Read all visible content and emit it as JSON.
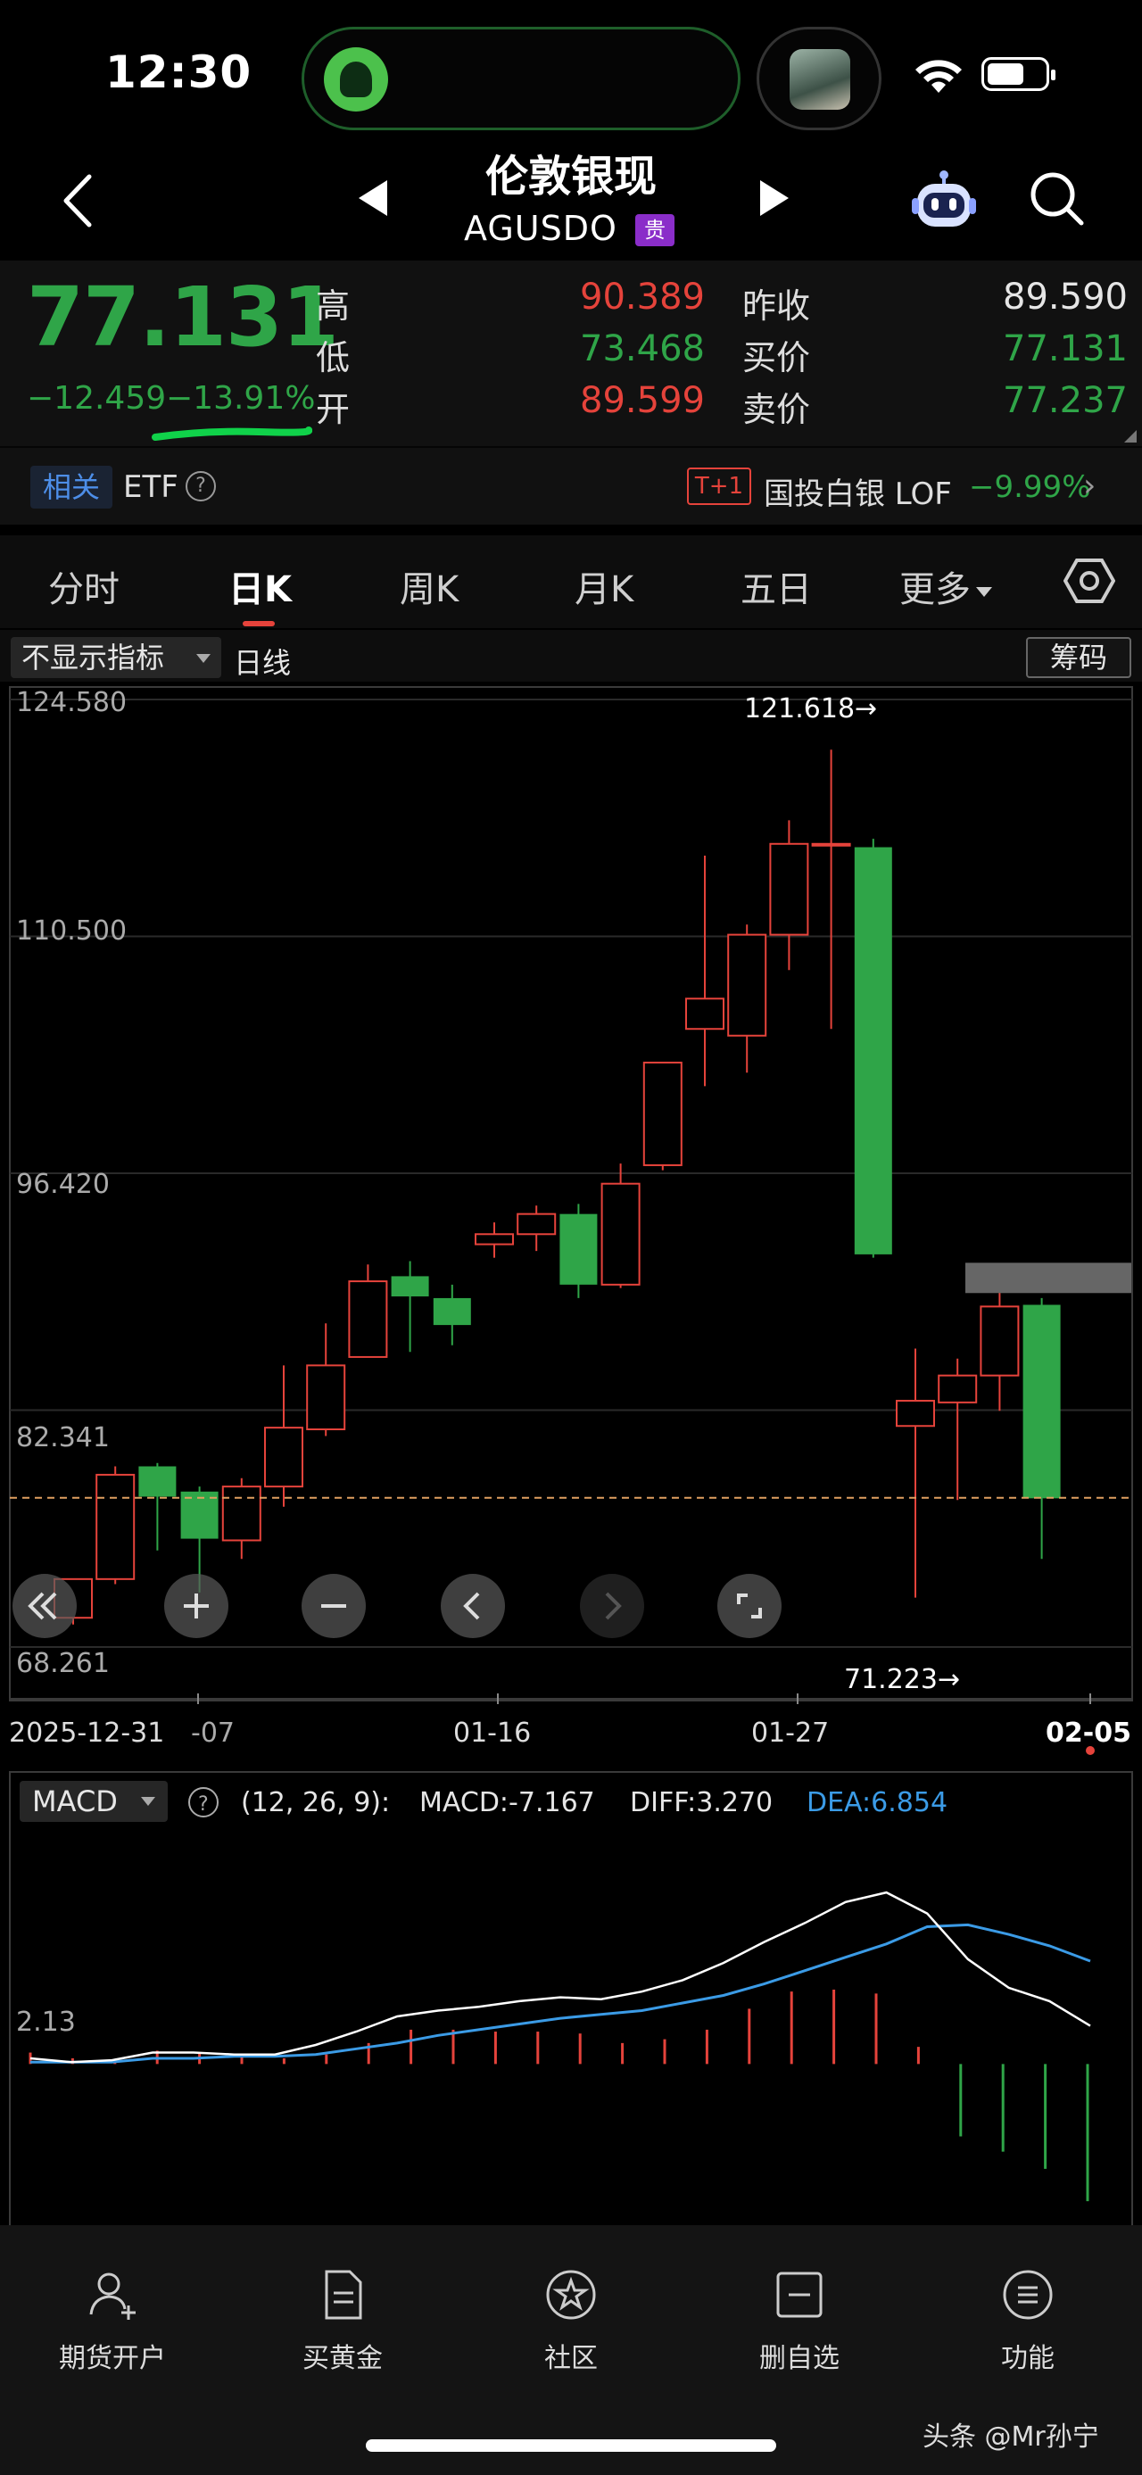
{
  "status": {
    "time": "12:30"
  },
  "header": {
    "title": "伦敦银现",
    "symbol": "AGUSDO",
    "badge": "贵"
  },
  "quote": {
    "price": "77.131",
    "change": "−12.459",
    "change_pct": "−13.91%",
    "rows": [
      {
        "label": "高",
        "value": "90.389",
        "label2": "昨收",
        "value2": "89.590"
      },
      {
        "label": "低",
        "value": "73.468",
        "label2": "买价",
        "value2": "77.131"
      },
      {
        "label": "开",
        "value": "89.599",
        "label2": "卖价",
        "value2": "77.237"
      }
    ]
  },
  "etf_bar": {
    "related": "相关",
    "etf": "ETF",
    "help": "?",
    "t1": "T+1",
    "lof_name": "国投白银 LOF",
    "lof_change": "−9.99%",
    "arrow": "›"
  },
  "tabs": [
    {
      "label": "分时"
    },
    {
      "label": "日K"
    },
    {
      "label": "周K"
    },
    {
      "label": "月K"
    },
    {
      "label": "五日"
    },
    {
      "label": "更多"
    }
  ],
  "indicator_bar": {
    "select": "不显示指标",
    "line": "日线",
    "chip_button": "筹码"
  },
  "colors": {
    "up": "#e5433b",
    "down": "#2fa548",
    "dif": "#ffffff",
    "dea": "#3b9be6"
  },
  "chart_data": {
    "type": "candlestick",
    "y_ticks": [
      "124.580",
      "110.500",
      "96.420",
      "82.341",
      "68.261"
    ],
    "ylim": [
      68.261,
      124.58
    ],
    "x_labels": [
      "2025-12-31",
      "-07",
      "01-16",
      "01-27",
      "02-05"
    ],
    "max_label": "121.618→",
    "min_label": "71.223→",
    "last_close": 77.131,
    "candles": [
      {
        "o": 70.0,
        "h": 72.0,
        "l": 69.6,
        "c": 72.3
      },
      {
        "o": 72.3,
        "h": 79.0,
        "l": 72.0,
        "c": 78.5
      },
      {
        "o": 79.0,
        "h": 79.2,
        "l": 74.0,
        "c": 77.2
      },
      {
        "o": 77.5,
        "h": 77.8,
        "l": 71.5,
        "c": 74.7
      },
      {
        "o": 74.6,
        "h": 78.3,
        "l": 73.5,
        "c": 77.8
      },
      {
        "o": 77.8,
        "h": 85.0,
        "l": 76.6,
        "c": 81.3
      },
      {
        "o": 81.2,
        "h": 87.5,
        "l": 80.8,
        "c": 85.0
      },
      {
        "o": 85.5,
        "h": 91.0,
        "l": 85.5,
        "c": 90.0
      },
      {
        "o": 90.3,
        "h": 91.2,
        "l": 85.8,
        "c": 89.1
      },
      {
        "o": 89.0,
        "h": 89.8,
        "l": 86.2,
        "c": 87.4
      },
      {
        "o": 92.2,
        "h": 93.5,
        "l": 91.4,
        "c": 92.8
      },
      {
        "o": 92.8,
        "h": 94.5,
        "l": 91.8,
        "c": 94.0
      },
      {
        "o": 94.0,
        "h": 94.6,
        "l": 89.0,
        "c": 89.8
      },
      {
        "o": 89.8,
        "h": 97.0,
        "l": 89.6,
        "c": 95.8
      },
      {
        "o": 96.9,
        "h": 103.0,
        "l": 96.6,
        "c": 103.0
      },
      {
        "o": 105.0,
        "h": 115.3,
        "l": 101.6,
        "c": 106.8
      },
      {
        "o": 104.6,
        "h": 111.2,
        "l": 102.4,
        "c": 110.6
      },
      {
        "o": 110.6,
        "h": 117.4,
        "l": 108.5,
        "c": 116.0
      },
      {
        "o": 116.0,
        "h": 121.6,
        "l": 105.0,
        "c": 116.0
      },
      {
        "o": 115.8,
        "h": 116.3,
        "l": 91.4,
        "c": 91.6
      },
      {
        "o": 81.4,
        "h": 86.0,
        "l": 71.2,
        "c": 82.9
      },
      {
        "o": 82.8,
        "h": 85.4,
        "l": 77.0,
        "c": 84.4
      },
      {
        "o": 84.4,
        "h": 89.6,
        "l": 82.3,
        "c": 88.5
      },
      {
        "o": 88.6,
        "h": 89.0,
        "l": 73.5,
        "c": 77.1
      }
    ],
    "ghost_bar": {
      "low": 89.3,
      "high": 91.1
    }
  },
  "macd": {
    "name": "MACD",
    "params": "(12, 26, 9):",
    "macd_text": "MACD:-7.167",
    "diff_text": "DIFF:3.270",
    "dea_text": "DEA:6.854",
    "axis_label": "2.13",
    "dif": [
      0.3,
      0.1,
      0.2,
      0.6,
      0.6,
      0.5,
      0.5,
      1.0,
      1.7,
      2.5,
      2.8,
      3.0,
      3.3,
      3.5,
      3.4,
      3.8,
      4.4,
      5.3,
      6.4,
      7.4,
      8.5,
      9.0,
      7.9,
      5.5,
      4.0,
      3.3,
      2.0
    ],
    "dea": [
      0.1,
      0.1,
      0.1,
      0.3,
      0.3,
      0.4,
      0.4,
      0.5,
      0.8,
      1.1,
      1.5,
      1.8,
      2.1,
      2.4,
      2.6,
      2.8,
      3.2,
      3.6,
      4.2,
      4.9,
      5.6,
      6.3,
      7.2,
      7.3,
      6.8,
      6.2,
      5.4
    ],
    "hist": [
      0.6,
      0.3,
      0.2,
      0.7,
      0.6,
      0.4,
      0.3,
      0.5,
      1.1,
      1.8,
      1.8,
      1.7,
      1.7,
      1.6,
      1.1,
      1.3,
      1.8,
      2.9,
      3.8,
      3.9,
      3.7,
      0.9,
      -3.8,
      -4.6,
      -5.5,
      -7.2
    ],
    "ylim": [
      -7.8,
      9.8
    ]
  },
  "bottom_nav": [
    {
      "label": "期货开户"
    },
    {
      "label": "买黄金"
    },
    {
      "label": "社区"
    },
    {
      "label": "删自选"
    },
    {
      "label": "功能"
    }
  ],
  "watermark": "头条 @Mr孙宁"
}
